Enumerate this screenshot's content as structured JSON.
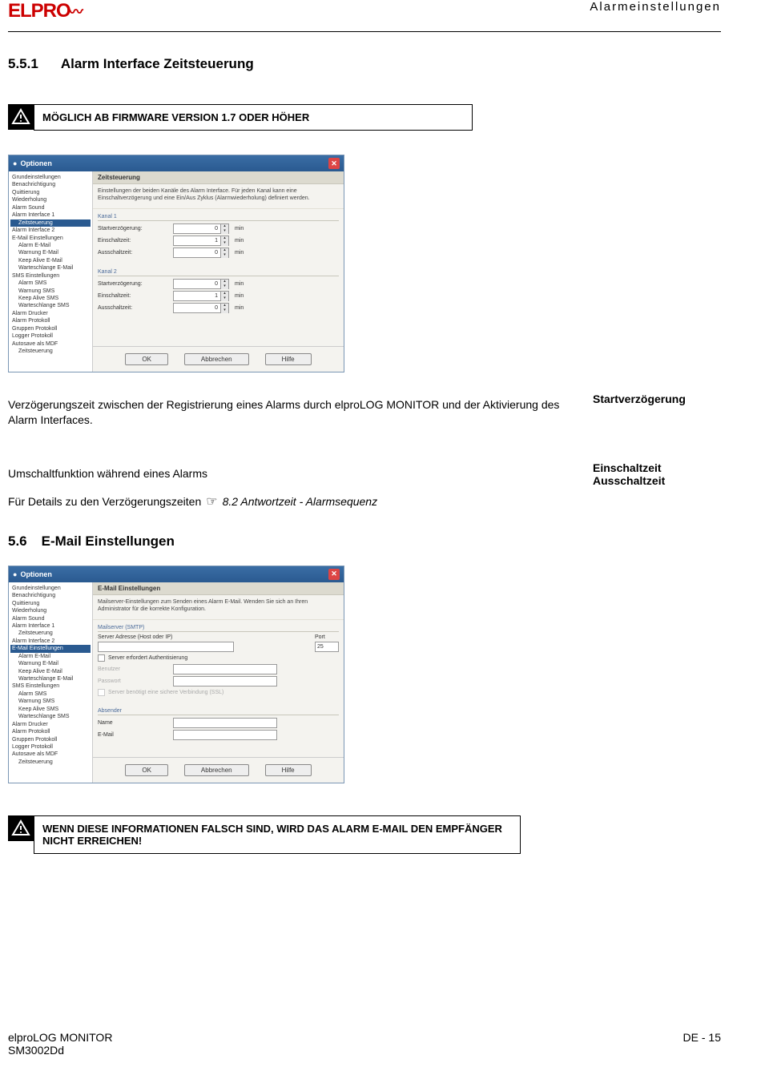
{
  "header": {
    "chapter": "Alarmeinstellungen"
  },
  "logo": {
    "text": "ELPRO"
  },
  "section551": {
    "num": "5.5.1",
    "title": "Alarm Interface Zeitsteuerung"
  },
  "alert1": {
    "text": "MÖGLICH AB FIRMWARE VERSION 1.7 ODER HÖHER"
  },
  "win1": {
    "title": "Optionen",
    "paneTitle": "Zeitsteuerung",
    "desc": "Einstellungen der beiden Kanäle des Alarm Interface. Für jeden Kanal kann eine Einschaltverzögerung und eine Ein/Aus Zyklus (Alarmwiederholung) definiert werden.",
    "tree": [
      "Grundeinstellungen",
      "Benachrichtigung",
      "Quittierung",
      "Wiederholung",
      "Alarm Sound",
      "Alarm Interface 1"
    ],
    "treeSel": "Zeitsteuerung",
    "tree2": [
      "Alarm Interface 2",
      "E-Mail Einstellungen"
    ],
    "treeSub2": [
      "Alarm E-Mail",
      "Warnung E-Mail",
      "Keep Alive E-Mail",
      "Warteschlange E-Mail"
    ],
    "tree3": [
      "SMS Einstellungen"
    ],
    "treeSub3": [
      "Alarm SMS",
      "Warnung SMS",
      "Keep Alive SMS",
      "Warteschlange SMS"
    ],
    "tree4": [
      "Alarm Drucker",
      "Alarm Protokoll",
      "Gruppen Protokoll",
      "Logger Protokoll",
      "Autosave als MDF"
    ],
    "treeSub4": [
      "Zeitsteuerung"
    ],
    "ch1": "Kanal 1",
    "ch2": "Kanal 2",
    "f1": "Startverzögerung:",
    "f2": "Einschaltzeit:",
    "f3": "Ausschaltzeit:",
    "v1": "0",
    "v2": "1",
    "v3": "0",
    "unit": "min",
    "btnOk": "OK",
    "btnCancel": "Abbrechen",
    "btnHelp": "Hilfe"
  },
  "para1": {
    "left": "Verzögerungszeit zwischen der Registrierung eines Alarms durch elproLOG MONITOR und der Aktivierung des Alarm Interfaces.",
    "right": "Startverzögerung"
  },
  "para2": {
    "left": "Umschaltfunktion während eines Alarms",
    "right1": "Einschaltzeit",
    "right2": "Ausschaltzeit"
  },
  "ref": {
    "pre": "Für Details zu den Verzögerungszeiten",
    "link": "8.2 Antwortzeit - Alarmsequenz"
  },
  "section56": {
    "num": "5.6",
    "title": "E-Mail Einstellungen"
  },
  "win2": {
    "title": "Optionen",
    "paneTitle": "E-Mail Einstellungen",
    "desc": "Mailserver-Einstellungen zum Senden eines Alarm E-Mail. Wenden Sie sich an Ihren Administrator für die korrekte Konfiguration.",
    "treeSel": "E-Mail Einstellungen",
    "grp1": "Mailserver (SMTP)",
    "lblServer": "Server Adresse (Host oder IP)",
    "lblPort": "Port",
    "portVal": "25",
    "cbAuth": "Server erfordert Authentisierung",
    "lblUser": "Benutzer",
    "lblPass": "Passwort",
    "cbSSL": "Server benötigt eine sichere Verbindung (SSL)",
    "grp2": "Absender",
    "lblName": "Name",
    "lblEmail": "E-Mail",
    "btnOk": "OK",
    "btnCancel": "Abbrechen",
    "btnHelp": "Hilfe"
  },
  "alert2": {
    "text": "WENN DIESE INFORMATIONEN FALSCH SIND, WIRD DAS ALARM E-MAIL DEN EMPFÄNGER NICHT ERREICHEN!"
  },
  "footer": {
    "product": "elproLOG MONITOR",
    "doc": "SM3002Dd",
    "page": "DE - 15"
  }
}
